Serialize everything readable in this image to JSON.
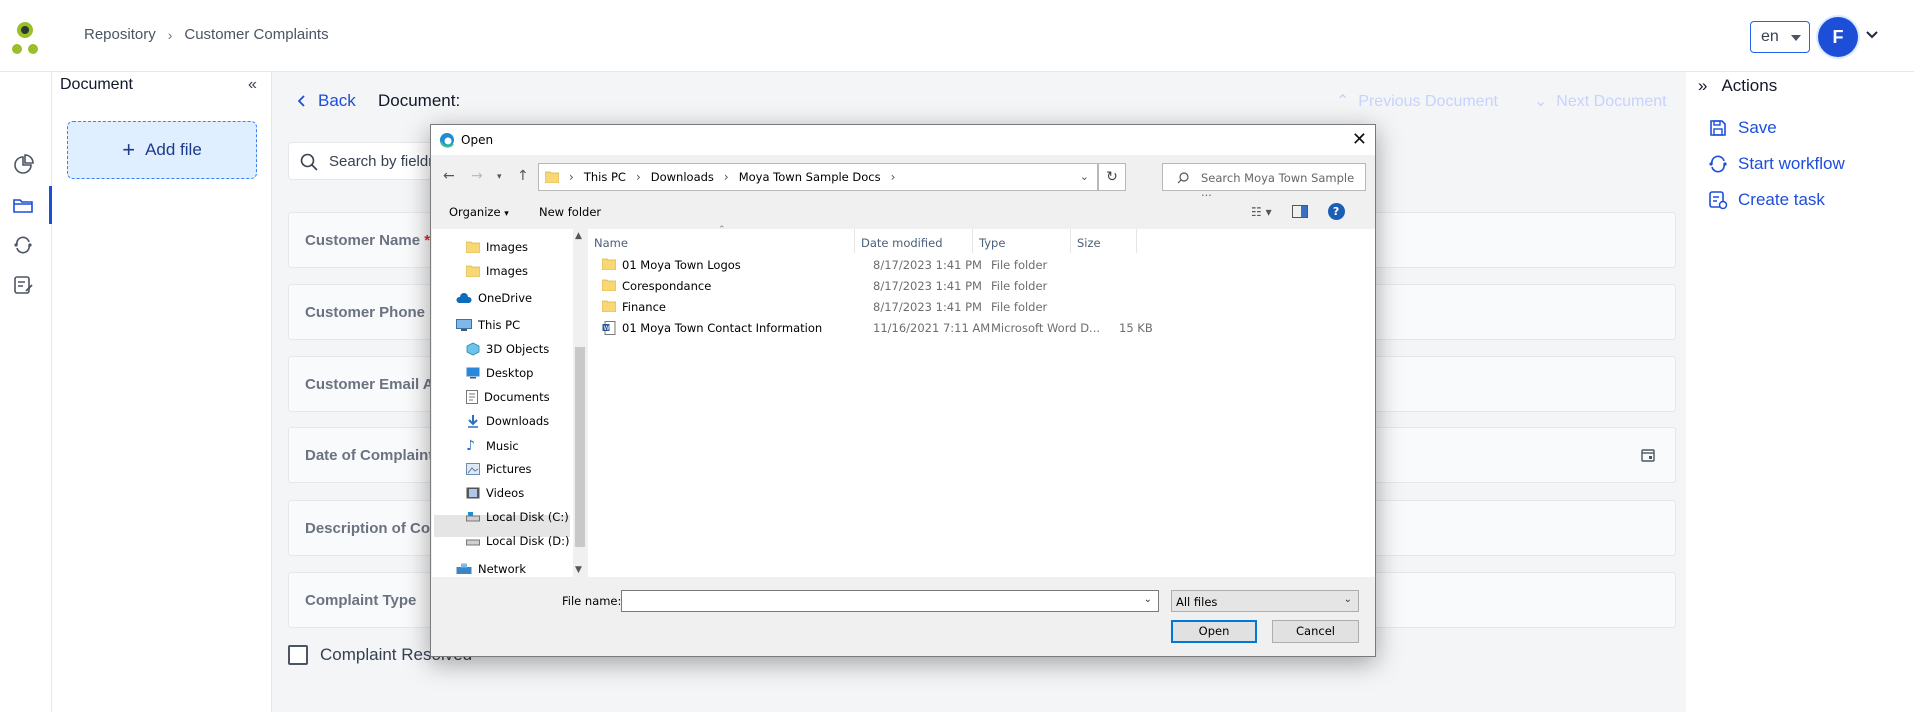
{
  "breadcrumb": {
    "items": [
      "Repository",
      "Customer Complaints"
    ],
    "separator": "›"
  },
  "header": {
    "language": "en",
    "avatar_initial": "F"
  },
  "document_panel": {
    "title": "Document",
    "add_file_label": "Add file"
  },
  "main": {
    "back_label": "Back",
    "document_label": "Document:",
    "previous_label": "Previous Document",
    "next_label": "Next Document",
    "search_placeholder": "Search by fieldn",
    "fields": [
      {
        "label": "Customer Name",
        "required": "*"
      },
      {
        "label": "Customer Phone Nu"
      },
      {
        "label": "Customer Email Add"
      },
      {
        "label": "Date of Complaint"
      },
      {
        "label": "Description of Comp"
      },
      {
        "label": "Complaint Type"
      }
    ],
    "checkbox_label": "Complaint Resolved"
  },
  "actions_panel": {
    "title": "Actions",
    "items": [
      "Save",
      "Start workflow",
      "Create task"
    ]
  },
  "dialog": {
    "title": "Open",
    "path": [
      "This PC",
      "Downloads",
      "Moya Town Sample Docs"
    ],
    "search_placeholder": "Search Moya Town Sample ...",
    "organize_label": "Organize",
    "new_folder_label": "New folder",
    "nav_items": [
      "Images",
      "Images",
      "OneDrive",
      "This PC",
      "3D Objects",
      "Desktop",
      "Documents",
      "Downloads",
      "Music",
      "Pictures",
      "Videos",
      "Local Disk (C:)",
      "Local Disk (D:)",
      "Network"
    ],
    "selected_nav": "Downloads",
    "columns": [
      "Name",
      "Date modified",
      "Type",
      "Size"
    ],
    "files": [
      {
        "name": "01 Moya Town Logos",
        "date": "8/17/2023 1:41 PM",
        "type": "File folder",
        "size": "",
        "icon": "folder-icon"
      },
      {
        "name": "Corespondance",
        "date": "8/17/2023 1:41 PM",
        "type": "File folder",
        "size": "",
        "icon": "folder-icon"
      },
      {
        "name": "Finance",
        "date": "8/17/2023 1:41 PM",
        "type": "File folder",
        "size": "",
        "icon": "folder-icon"
      },
      {
        "name": "01 Moya Town Contact Information",
        "date": "11/16/2021 7:11 AM",
        "type": "Microsoft Word D...",
        "size": "15 KB",
        "icon": "word-document-icon"
      }
    ],
    "file_name_label": "File name:",
    "file_name_value": "",
    "filter_value": "All files",
    "open_label": "Open",
    "cancel_label": "Cancel"
  },
  "colors": {
    "accent": "#1d4ed8",
    "dialog_bg": "#f0f0f0",
    "folder": "#f8d775"
  }
}
